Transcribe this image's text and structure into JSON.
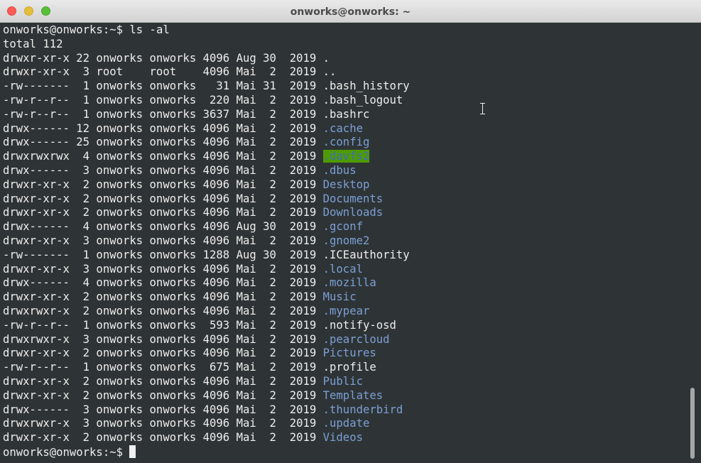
{
  "window": {
    "title": "onworks@onworks: ~"
  },
  "terminal": {
    "prompt": "onworks@onworks:~$",
    "command": " ls -al",
    "total": "total 112",
    "rows": [
      {
        "meta": "drwxr-xr-x 22 onworks onworks 4096 Aug 30  2019 ",
        "name": ".",
        "type": "file"
      },
      {
        "meta": "drwxr-xr-x  3 root    root    4096 Mai  2  2019 ",
        "name": "..",
        "type": "file"
      },
      {
        "meta": "-rw-------  1 onworks onworks   31 Mai 31  2019 ",
        "name": ".bash_history",
        "type": "file"
      },
      {
        "meta": "-rw-r--r--  1 onworks onworks  220 Mai  2  2019 ",
        "name": ".bash_logout",
        "type": "file"
      },
      {
        "meta": "-rw-r--r--  1 onworks onworks 3637 Mai  2  2019 ",
        "name": ".bashrc",
        "type": "file"
      },
      {
        "meta": "drwx------ 12 onworks onworks 4096 Mai  2  2019 ",
        "name": ".cache",
        "type": "dir"
      },
      {
        "meta": "drwx------ 25 onworks onworks 4096 Mai  2  2019 ",
        "name": ".config",
        "type": "dir"
      },
      {
        "meta": "drwxrwxrwx  4 onworks onworks 4096 Mai  2  2019 ",
        "name": ".davfs2",
        "type": "dir-ow"
      },
      {
        "meta": "drwx------  3 onworks onworks 4096 Mai  2  2019 ",
        "name": ".dbus",
        "type": "dir"
      },
      {
        "meta": "drwxr-xr-x  2 onworks onworks 4096 Mai  2  2019 ",
        "name": "Desktop",
        "type": "dir"
      },
      {
        "meta": "drwxr-xr-x  2 onworks onworks 4096 Mai  2  2019 ",
        "name": "Documents",
        "type": "dir"
      },
      {
        "meta": "drwxr-xr-x  2 onworks onworks 4096 Mai  2  2019 ",
        "name": "Downloads",
        "type": "dir"
      },
      {
        "meta": "drwx------  4 onworks onworks 4096 Aug 30  2019 ",
        "name": ".gconf",
        "type": "dir"
      },
      {
        "meta": "drwxr-xr-x  3 onworks onworks 4096 Mai  2  2019 ",
        "name": ".gnome2",
        "type": "dir"
      },
      {
        "meta": "-rw-------  1 onworks onworks 1288 Aug 30  2019 ",
        "name": ".ICEauthority",
        "type": "file"
      },
      {
        "meta": "drwxr-xr-x  3 onworks onworks 4096 Mai  2  2019 ",
        "name": ".local",
        "type": "dir"
      },
      {
        "meta": "drwx------  4 onworks onworks 4096 Mai  2  2019 ",
        "name": ".mozilla",
        "type": "dir"
      },
      {
        "meta": "drwxr-xr-x  2 onworks onworks 4096 Mai  2  2019 ",
        "name": "Music",
        "type": "dir"
      },
      {
        "meta": "drwxrwxr-x  2 onworks onworks 4096 Mai  2  2019 ",
        "name": ".mypear",
        "type": "dir"
      },
      {
        "meta": "-rw-r--r--  1 onworks onworks  593 Mai  2  2019 ",
        "name": ".notify-osd",
        "type": "file"
      },
      {
        "meta": "drwxrwxr-x  3 onworks onworks 4096 Mai  2  2019 ",
        "name": ".pearcloud",
        "type": "dir"
      },
      {
        "meta": "drwxr-xr-x  2 onworks onworks 4096 Mai  2  2019 ",
        "name": "Pictures",
        "type": "dir"
      },
      {
        "meta": "-rw-r--r--  1 onworks onworks  675 Mai  2  2019 ",
        "name": ".profile",
        "type": "file"
      },
      {
        "meta": "drwxr-xr-x  2 onworks onworks 4096 Mai  2  2019 ",
        "name": "Public",
        "type": "dir"
      },
      {
        "meta": "drwxr-xr-x  2 onworks onworks 4096 Mai  2  2019 ",
        "name": "Templates",
        "type": "dir"
      },
      {
        "meta": "drwx------  3 onworks onworks 4096 Mai  2  2019 ",
        "name": ".thunderbird",
        "type": "dir"
      },
      {
        "meta": "drwxrwxr-x  3 onworks onworks 4096 Mai  2  2019 ",
        "name": ".update",
        "type": "dir"
      },
      {
        "meta": "drwxr-xr-x  2 onworks onworks 4096 Mai  2  2019 ",
        "name": "Videos",
        "type": "dir"
      }
    ],
    "final_prompt": "onworks@onworks:~$ "
  },
  "colors": {
    "background": "#2e3436",
    "text": "#eeeeec",
    "directory": "#7c9fd4",
    "other_writable_bg": "#4e9a06"
  },
  "icons": {
    "close": "close-icon",
    "minimize": "minimize-icon",
    "maximize": "maximize-icon",
    "pointer": "text-cursor-icon"
  }
}
